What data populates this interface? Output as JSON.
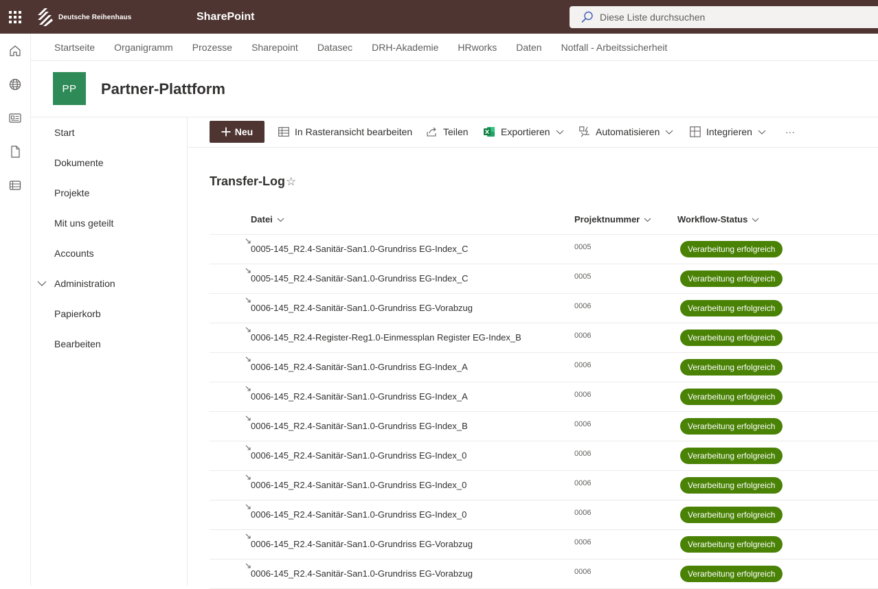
{
  "suite": {
    "brand": "Deutsche Reihenhaus",
    "app_name": "SharePoint",
    "search_placeholder": "Diese Liste durchsuchen"
  },
  "rail": {
    "icons": [
      "home-icon",
      "globe-icon",
      "news-icon",
      "file-icon",
      "list-icon"
    ]
  },
  "hubnav": {
    "items": [
      "Startseite",
      "Organigramm",
      "Prozesse",
      "Sharepoint",
      "Datasec",
      "DRH-Akademie",
      "HRworks",
      "Daten",
      "Notfall - Arbeitssicherheit"
    ]
  },
  "site": {
    "logo_initials": "PP",
    "title": "Partner-Plattform"
  },
  "leftnav": {
    "items": [
      "Start",
      "Dokumente",
      "Projekte",
      "Mit uns geteilt",
      "Accounts",
      "Administration",
      "Papierkorb",
      "Bearbeiten"
    ]
  },
  "commands": {
    "new": "Neu",
    "grid_edit": "In Rasteransicht bearbeiten",
    "share": "Teilen",
    "export": "Exportieren",
    "automate": "Automatisieren",
    "integrate": "Integrieren",
    "more": "···"
  },
  "list": {
    "title": "Transfer-Log",
    "columns": [
      "Datei",
      "Projektnummer",
      "Workflow-Status"
    ],
    "rows": [
      {
        "file": "0005-145_R2.4-Sanitär-San1.0-Grundriss EG-Index_C",
        "project": "0005",
        "status": "Verarbeitung erfolgreich"
      },
      {
        "file": "0005-145_R2.4-Sanitär-San1.0-Grundriss EG-Index_C",
        "project": "0005",
        "status": "Verarbeitung erfolgreich"
      },
      {
        "file": "0006-145_R2.4-Sanitär-San1.0-Grundriss EG-Vorabzug",
        "project": "0006",
        "status": "Verarbeitung erfolgreich"
      },
      {
        "file": "0006-145_R2.4-Register-Reg1.0-Einmessplan Register EG-Index_B",
        "project": "0006",
        "status": "Verarbeitung erfolgreich"
      },
      {
        "file": "0006-145_R2.4-Sanitär-San1.0-Grundriss EG-Index_A",
        "project": "0006",
        "status": "Verarbeitung erfolgreich"
      },
      {
        "file": "0006-145_R2.4-Sanitär-San1.0-Grundriss EG-Index_A",
        "project": "0006",
        "status": "Verarbeitung erfolgreich"
      },
      {
        "file": "0006-145_R2.4-Sanitär-San1.0-Grundriss EG-Index_B",
        "project": "0006",
        "status": "Verarbeitung erfolgreich"
      },
      {
        "file": "0006-145_R2.4-Sanitär-San1.0-Grundriss EG-Index_0",
        "project": "0006",
        "status": "Verarbeitung erfolgreich"
      },
      {
        "file": "0006-145_R2.4-Sanitär-San1.0-Grundriss EG-Index_0",
        "project": "0006",
        "status": "Verarbeitung erfolgreich"
      },
      {
        "file": "0006-145_R2.4-Sanitär-San1.0-Grundriss EG-Index_0",
        "project": "0006",
        "status": "Verarbeitung erfolgreich"
      },
      {
        "file": "0006-145_R2.4-Sanitär-San1.0-Grundriss EG-Vorabzug",
        "project": "0006",
        "status": "Verarbeitung erfolgreich"
      },
      {
        "file": "0006-145_R2.4-Sanitär-San1.0-Grundriss EG-Vorabzug",
        "project": "0006",
        "status": "Verarbeitung erfolgreich"
      }
    ]
  },
  "colors": {
    "suite_bar": "#4e3531",
    "new_button": "#4e3531",
    "site_logo": "#2e8b57",
    "status_success": "#498205",
    "excel_green": "#107c41"
  }
}
